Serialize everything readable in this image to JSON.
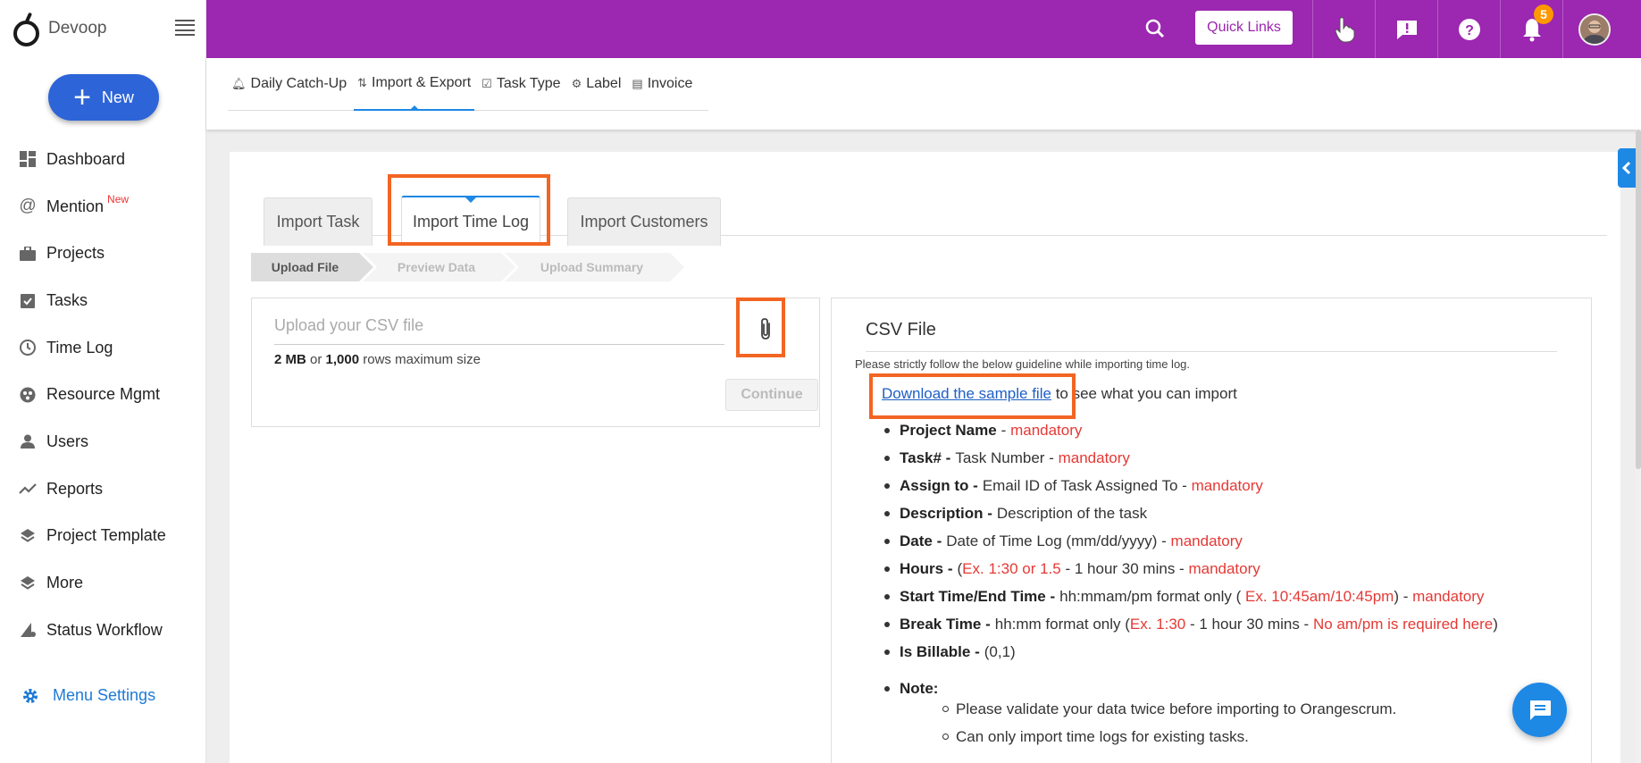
{
  "sidebar": {
    "brand": "Devoop",
    "new_label": "New",
    "items": [
      {
        "label": "Dashboard",
        "icon": "dashboard-icon"
      },
      {
        "label": "Mention",
        "icon": "at-icon",
        "badge": "New"
      },
      {
        "label": "Projects",
        "icon": "briefcase-icon"
      },
      {
        "label": "Tasks",
        "icon": "clipboard-check-icon"
      },
      {
        "label": "Time Log",
        "icon": "clock-icon"
      },
      {
        "label": "Resource Mgmt",
        "icon": "resource-icon"
      },
      {
        "label": "Users",
        "icon": "user-icon"
      },
      {
        "label": "Reports",
        "icon": "trend-icon"
      },
      {
        "label": "Project Template",
        "icon": "layers-icon"
      },
      {
        "label": "More",
        "icon": "layers-icon"
      },
      {
        "label": "Status Workflow",
        "icon": "workflow-icon"
      }
    ],
    "menu_settings": "Menu Settings"
  },
  "header": {
    "quick_links": "Quick Links",
    "notification_count": "5",
    "brand_color": "#9c27b0"
  },
  "subnav": {
    "tabs": [
      {
        "label": "Daily Catch-Up",
        "icon": "bell-icon"
      },
      {
        "label": "Import & Export",
        "icon": "import-export-icon",
        "active": true
      },
      {
        "label": "Task Type",
        "icon": "checkbox-icon"
      },
      {
        "label": "Label",
        "icon": "gear-icon"
      },
      {
        "label": "Invoice",
        "icon": "invoice-icon"
      }
    ]
  },
  "import": {
    "tabs": [
      "Import Task",
      "Import Time Log",
      "Import Customers"
    ],
    "active_tab": "Import Time Log",
    "steps": [
      "Upload File",
      "Preview Data",
      "Upload Summary"
    ],
    "upload": {
      "placeholder": "Upload your CSV file",
      "size_mb": "2 MB",
      "or": "or",
      "rows": "1,000",
      "size_suffix": "rows maximum size",
      "continue": "Continue"
    },
    "csv": {
      "title": "CSV File",
      "guideline": "Please strictly follow the below guideline while importing time log.",
      "download_link": "Download the sample file",
      "download_suffix": "to see what you can import",
      "fields": [
        {
          "name": "Project Name",
          "sep": "-",
          "desc": "",
          "red": "mandatory"
        },
        {
          "name": "Task# -",
          "sep": "",
          "desc": "Task Number -",
          "red": "mandatory"
        },
        {
          "name": "Assign to -",
          "sep": "",
          "desc": "Email ID of Task Assigned To -",
          "red": "mandatory"
        },
        {
          "name": "Description -",
          "sep": "",
          "desc": "Description of the task",
          "red": ""
        },
        {
          "name": "Date -",
          "sep": "",
          "desc": "Date of Time Log (mm/dd/yyyy) -",
          "red": "mandatory"
        }
      ],
      "hours": {
        "name": "Hours -",
        "pre": "(",
        "ex": "Ex. 1:30 or 1.5",
        "mid": "- 1 hour 30 mins -",
        "red": "mandatory"
      },
      "start_end": {
        "name": "Start Time/End Time -",
        "pre": "hh:mmam/pm format only (",
        "ex": "Ex. 10:45am/10:45pm",
        "mid": ") -",
        "red": "mandatory"
      },
      "break_time": {
        "name": "Break Time -",
        "pre": "hh:mm format only (",
        "ex": "Ex. 1:30",
        "mid": "- 1 hour 30 mins -",
        "red": "No am/pm is required here",
        "post": ")"
      },
      "billable": {
        "name": "Is Billable -",
        "desc": "(0,1)"
      },
      "note_label": "Note:",
      "notes": [
        "Please validate your data twice before importing to Orangescrum.",
        "Can only import time logs for existing tasks."
      ]
    }
  }
}
